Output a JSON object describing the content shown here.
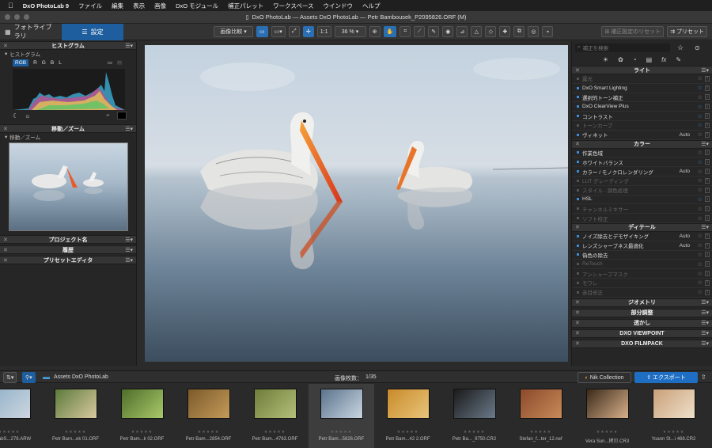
{
  "menubar": {
    "app": "DxO PhotoLab 9",
    "items": [
      "ファイル",
      "編集",
      "表示",
      "画像",
      "DxO モジュール",
      "補正パレット",
      "ワークスペース",
      "ウインドウ",
      "ヘルプ"
    ]
  },
  "window_title": "DxO PhotoLab — Assets DxO PhotoLab — Petr Bambousek_P2095826.ORF (M)",
  "toolbar": {
    "tab_library": "フォトライブラリ",
    "tab_customize": "設定",
    "compare": "画像比較",
    "ratio": "1:1",
    "zoom": "36 %",
    "reset": "補正設定のリセット",
    "preset": "プリセット"
  },
  "left": {
    "histogram_title": "ヒストグラム",
    "histogram_sub": "ヒストグラム",
    "channels": [
      "RGB",
      "R",
      "G",
      "B",
      "L"
    ],
    "nav_title": "移動／ズーム",
    "nav_sub": "移動／ズーム",
    "project": "プロジェクト名",
    "history": "履歴",
    "preset_editor": "プリセットエディタ"
  },
  "right": {
    "search_placeholder": "補正を検索",
    "light_title": "ライト",
    "light_rows": [
      {
        "label": "露光",
        "dim": true,
        "auto": "",
        "star": false
      },
      {
        "label": "DxO Smart Lighting",
        "dim": false,
        "auto": "",
        "star": true
      },
      {
        "label": "選択的トーン補正",
        "dim": false,
        "auto": "",
        "star": false
      },
      {
        "label": "DxO ClearView Plus",
        "dim": false,
        "auto": "",
        "star": true
      },
      {
        "label": "コントラスト",
        "dim": false,
        "auto": "",
        "star": true
      },
      {
        "label": "トーンカーブ",
        "dim": true,
        "auto": "",
        "star": true
      },
      {
        "label": "ヴィネット",
        "dim": false,
        "auto": "Auto",
        "star": false
      }
    ],
    "color_title": "カラー",
    "color_rows": [
      {
        "label": "作業色域",
        "dim": false,
        "auto": "",
        "star": false
      },
      {
        "label": "ホワイトバランス",
        "dim": false,
        "auto": "",
        "star": true
      },
      {
        "label": "カラー / モノクロレンダリング",
        "dim": false,
        "auto": "Auto",
        "star": false
      },
      {
        "label": "LUT グレーディング",
        "dim": true,
        "auto": "",
        "star": false
      },
      {
        "label": "スタイル - 調色処理",
        "dim": true,
        "auto": "",
        "star": false
      },
      {
        "label": "HSL",
        "dim": false,
        "auto": "",
        "star": true
      },
      {
        "label": "チャンネルミキサー",
        "dim": true,
        "auto": "",
        "star": false
      },
      {
        "label": "ソフト校正",
        "dim": true,
        "auto": "",
        "star": false
      }
    ],
    "detail_title": "ディテール",
    "detail_rows": [
      {
        "label": "ノイズ除去とデモザイキング",
        "dim": false,
        "auto": "Auto",
        "star": false
      },
      {
        "label": "レンズシャープネス最適化",
        "dim": false,
        "auto": "Auto",
        "star": false
      },
      {
        "label": "偽色の除去",
        "dim": false,
        "auto": "",
        "star": false
      },
      {
        "label": "ReTouch",
        "dim": true,
        "auto": "",
        "star": false
      },
      {
        "label": "アンシャープマスク",
        "dim": true,
        "auto": "",
        "star": false
      },
      {
        "label": "モワレ",
        "dim": true,
        "auto": "",
        "star": false
      },
      {
        "label": "赤目修正",
        "dim": true,
        "auto": "",
        "star": false
      }
    ],
    "geometry_title": "ジオメトリ",
    "local_title": "部分調整",
    "watermark_title": "透かし",
    "viewpoint_title": "DXO VIEWPOINT",
    "filmpack_title": "DXO FILMPACK"
  },
  "filmbar": {
    "folder": "Assets DxO PhotoLab",
    "count_label": "画像枚数：",
    "count": "1/35",
    "nik": "Nik Collection",
    "export": "エクスポート"
  },
  "thumbnails": [
    {
      "name": "NohcabS...278.ARW",
      "c1": "#8fb0c8",
      "c2": "#cdd6df",
      "sel": false
    },
    {
      "name": "Petr Bam...ek 01.ORF",
      "c1": "#5c7a3a",
      "c2": "#d9c9a0",
      "sel": false
    },
    {
      "name": "Petr Bam...k 02.ORF",
      "c1": "#4f6d2a",
      "c2": "#a9c96a",
      "sel": false
    },
    {
      "name": "Petr Bam...2854.ORF",
      "c1": "#7b5a2a",
      "c2": "#c49a5a",
      "sel": false
    },
    {
      "name": "Petr Bam...4763.ORF",
      "c1": "#6f7d3a",
      "c2": "#b3bf7a",
      "sel": false
    },
    {
      "name": "Petr Bam...5826.ORF",
      "c1": "#5b738c",
      "c2": "#c9d6e2",
      "sel": true
    },
    {
      "name": "Petr Bam...42 2.ORF",
      "c1": "#c98a2a",
      "c2": "#e8c57a",
      "sel": false
    },
    {
      "name": "Petr Ba..._9750.CR2",
      "c1": "#1a1a1a",
      "c2": "#6a7a8a",
      "sel": false
    },
    {
      "name": "Stefan_f...ter_12.nef",
      "c1": "#8a4a2a",
      "c2": "#c98a5a",
      "sel": false
    },
    {
      "name": "Vera Sun...拷贝.CR3",
      "c1": "#3a2a1a",
      "c2": "#d9b08a",
      "sel": false
    },
    {
      "name": "Yoann St...i 468.CR2",
      "c1": "#c9a07a",
      "c2": "#efe0c9",
      "sel": false
    }
  ]
}
